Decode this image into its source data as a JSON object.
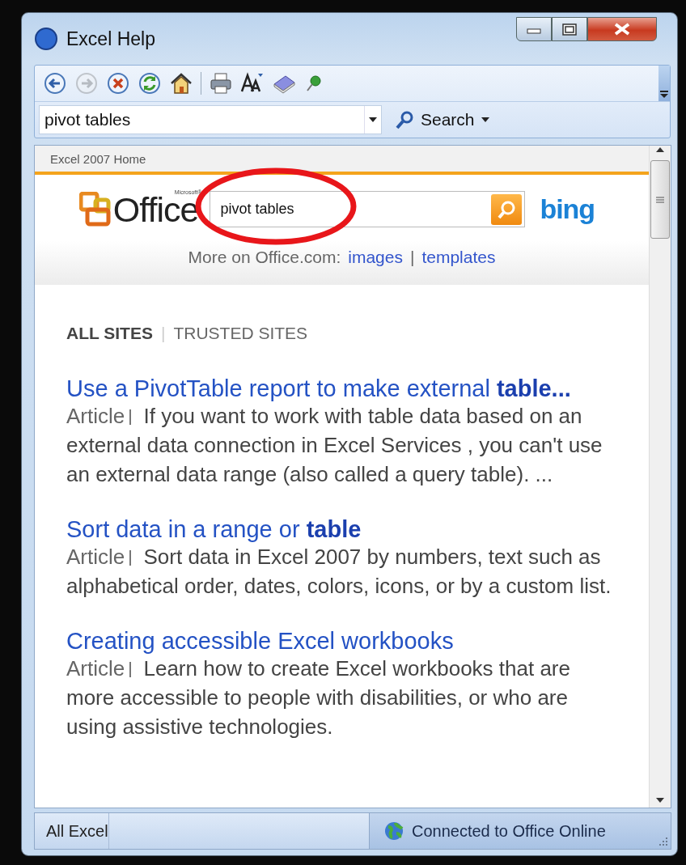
{
  "window": {
    "title": "Excel Help"
  },
  "toolbar_groups": [
    [
      {
        "kind": "back",
        "disabled": false
      },
      {
        "kind": "forward",
        "disabled": true
      },
      {
        "kind": "stop",
        "disabled": false
      },
      {
        "kind": "refresh",
        "disabled": false
      },
      {
        "kind": "home",
        "disabled": false
      }
    ],
    [
      {
        "kind": "print",
        "disabled": false
      },
      {
        "kind": "font-size",
        "disabled": false
      },
      {
        "kind": "book",
        "disabled": false
      },
      {
        "kind": "pin",
        "disabled": false
      }
    ]
  ],
  "search_bar": {
    "value": "pivot tables",
    "button": "Search"
  },
  "breadcrumb": "Excel 2007 Home",
  "office_header": {
    "logo": "Office",
    "logo_mark": "Microsoft®",
    "search_value": "pivot tables",
    "engine": "bing",
    "more_label": "More on Office.com:",
    "links": [
      "images",
      "templates"
    ],
    "link_separator": "|"
  },
  "scopes": [
    {
      "label": "ALL SITES",
      "selected": true
    },
    {
      "label": "TRUSTED SITES",
      "selected": false
    }
  ],
  "scope_separator": "|",
  "results": [
    {
      "title": "Use a PivotTable report to make external **table...**",
      "type": "Article",
      "snippet": "If you want to work with table data based on an external data connection in Excel Services , you can't use an external data range (also called a query table). ..."
    },
    {
      "title": "Sort data in a range or **table**",
      "type": "Article",
      "snippet": "Sort data in Excel 2007 by numbers, text such as alphabetical order, dates, colors, icons, or by a custom list."
    },
    {
      "title": "Creating accessible Excel workbooks",
      "type": "Article",
      "snippet": "Learn how to create Excel workbooks that are more accessible to people with disabilities, or who are using assistive technologies."
    }
  ],
  "status_bar": {
    "scope": "All Excel",
    "connection": "Connected to Office Online"
  }
}
